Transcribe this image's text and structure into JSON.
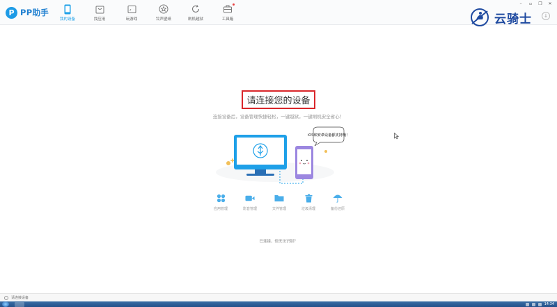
{
  "app": {
    "name": "PP助手",
    "logo_letter": "P"
  },
  "nav": [
    {
      "label": "我的设备",
      "icon": "phone-icon",
      "active": true,
      "badge": false
    },
    {
      "label": "找应用",
      "icon": "bag-icon",
      "active": false,
      "badge": false
    },
    {
      "label": "玩游戏",
      "icon": "gamepad-icon",
      "active": false,
      "badge": false
    },
    {
      "label": "铃声壁纸",
      "icon": "star-icon",
      "active": false,
      "badge": false
    },
    {
      "label": "刷机越狱",
      "icon": "refresh-icon",
      "active": false,
      "badge": false
    },
    {
      "label": "工具箱",
      "icon": "toolbox-icon",
      "active": false,
      "badge": true
    }
  ],
  "window_controls": {
    "minimize": "–",
    "maximize": "▫",
    "restore": "❐",
    "close": "✕"
  },
  "watermark": {
    "text": "云骑士"
  },
  "main": {
    "title": "请连接您的设备",
    "subtitle": "连接设备后，设备管理快捷轻松，一键越狱，一键刷机安全省心！",
    "bubble_text": "iOS和安卓设备都支持哦！",
    "help_text": "已连接，但无法识别？"
  },
  "features": [
    {
      "label": "应用管理",
      "icon": "apps-icon"
    },
    {
      "label": "影音管理",
      "icon": "video-icon"
    },
    {
      "label": "文件管理",
      "icon": "folder-icon"
    },
    {
      "label": "垃圾清理",
      "icon": "trash-icon"
    },
    {
      "label": "备份还原",
      "icon": "umbrella-icon"
    }
  ],
  "status": {
    "text": "请连接设备"
  },
  "taskbar": {
    "clock": "14:34"
  },
  "colors": {
    "accent": "#1ea0e8",
    "highlight_border": "#d9262a",
    "watermark": "#1f4aa0"
  }
}
